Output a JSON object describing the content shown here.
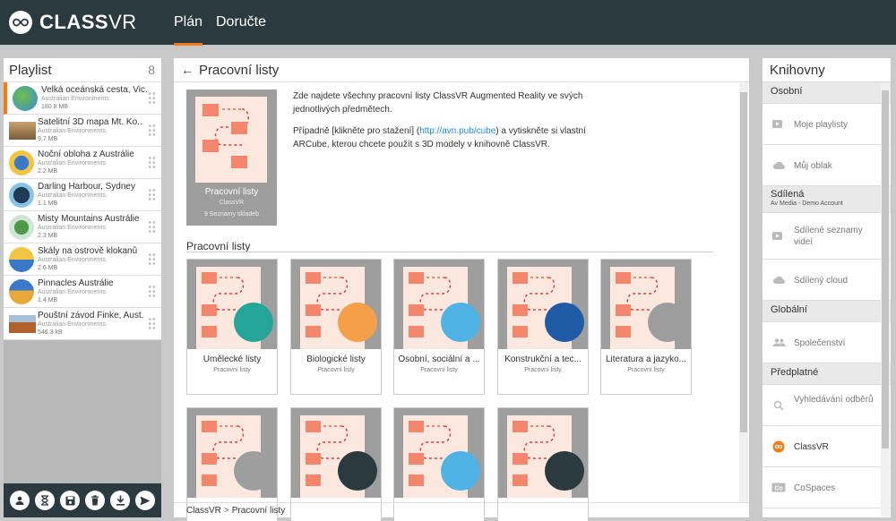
{
  "app": {
    "brand_bold": "CLASS",
    "brand_light": "VR"
  },
  "nav": {
    "tabs": [
      "Plán",
      "Doručte"
    ]
  },
  "playlist": {
    "title": "Playlist",
    "count": "8",
    "items": [
      {
        "title": "Velká oceánská cesta, Vic...",
        "sub": "Australian Environments",
        "size": "180.8 MB"
      },
      {
        "title": "Satelitní 3D mapa Mt. Ko...",
        "sub": "Australian Environments",
        "size": "9.7 MB"
      },
      {
        "title": "Noční obloha z Austrálie",
        "sub": "Australian Environments",
        "size": "2.2 MB"
      },
      {
        "title": "Darling Harbour, Sydney",
        "sub": "Australian Environments",
        "size": "1.1 MB"
      },
      {
        "title": "Misty Mountains Austrálie",
        "sub": "Australian Environments",
        "size": "2.3 MB"
      },
      {
        "title": "Skály na ostrově klokanů",
        "sub": "Australian Environments",
        "size": "2.6 MB"
      },
      {
        "title": "Pinnacles Austrálie",
        "sub": "Australian Environments",
        "size": "1.4 MB"
      },
      {
        "title": "Pouštní závod Finke, Aust...",
        "sub": "Australian Environments",
        "size": "546.3 kB"
      }
    ]
  },
  "main": {
    "title": "Pracovní listy",
    "feature": {
      "name": "Pracovní listy",
      "publisher": "ClassVR",
      "count": "9 Seznamy skladeb"
    },
    "desc1": "Zde najdete všechny pracovní listy ClassVR Augmented Reality ve svých jednotlivých předmětech.",
    "desc2a": "Případně [klikněte pro stažení] (",
    "desc2link": "http://avn.pub/cube",
    "desc2b": ") a vytiskněte si vlastní ARCube, kterou chcete použít s 3D modely v knihovně ClassVR.",
    "section": "Pracovní listy",
    "cards": [
      {
        "name": "Umělecké listy",
        "meta": "Pracovní listy"
      },
      {
        "name": "Biologické listy",
        "meta": "Pracovní listy"
      },
      {
        "name": "Osobní, sociální a ...",
        "meta": "Pracovní listy"
      },
      {
        "name": "Konstrukční a tec...",
        "meta": "Pracovní listy"
      },
      {
        "name": "Literatura a jazyko...",
        "meta": "Pracovní listy"
      },
      {
        "name": "",
        "meta": ""
      },
      {
        "name": "",
        "meta": ""
      },
      {
        "name": "",
        "meta": ""
      },
      {
        "name": "",
        "meta": ""
      }
    ],
    "breadcrumb": [
      "ClassVR",
      "Pracovní listy"
    ]
  },
  "libraries": {
    "title": "Knihovny",
    "groups": {
      "personal": "Osobní",
      "shared": "Sdílená",
      "shared_sub": "Av Media - Demo Account",
      "global": "Globální",
      "subs": "Předplatné"
    },
    "items": {
      "my_playlists": "Moje playlisty",
      "my_cloud": "Můj oblak",
      "shared_playlists": "Sdílené seznamy videí",
      "shared_cloud": "Sdílený cloud",
      "community": "Společenství",
      "sub_search": "Vyhledávání odběrů",
      "classvr": "ClassVR",
      "cospaces": "CoSpaces"
    }
  },
  "colors": {
    "accent": "#f07d1a",
    "topbar": "#2b3a3f",
    "link": "#1e88e5"
  }
}
